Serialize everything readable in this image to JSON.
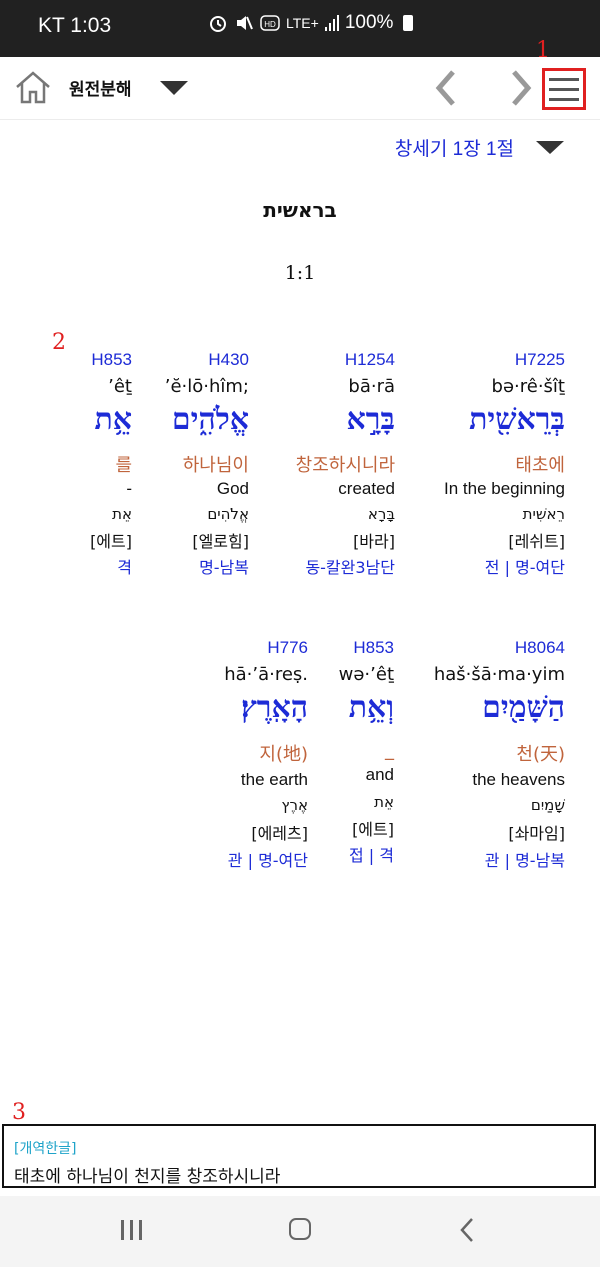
{
  "status_bar": {
    "carrier_time": "KT 1:03",
    "icons": [
      "alarm-icon",
      "mute-icon",
      "hd-icon",
      "lte-icon",
      "signal-icon"
    ],
    "network": "LTE+",
    "battery": "100%"
  },
  "toolbar": {
    "title": "원전분해",
    "annotation": "1"
  },
  "reference": "창세기 1장 1절",
  "book_title": "בראשית",
  "chapter_verse": "1:1",
  "annotation_words": "2",
  "annotation_translation": "3",
  "rows": [
    [
      {
        "strong": "H7225",
        "translit": "bə·rê·šîṯ",
        "hebrew": "בְּרֵאשִׁ֖ית",
        "korean": "태초에",
        "english": "In the beginning",
        "lemma": "רֵאשִׁית",
        "pron": "[레쉬트]",
        "gram": "전 | 명-여단"
      },
      {
        "strong": "H1254",
        "translit": "bā·rā",
        "hebrew": "בָּרָ֣א",
        "korean": "창조하시니라",
        "english": "created",
        "lemma": "בָּרָא",
        "pron": "[바라]",
        "gram": "동-칼완3남단"
      },
      {
        "strong": "H430",
        "translit": "’ĕ·lō·hîm;",
        "hebrew": "אֱלֹהִ֑ים",
        "korean": "하나님이",
        "english": "God",
        "lemma": "אֱלֹהִים",
        "pron": "[엘로힘]",
        "gram": "명-남복"
      },
      {
        "strong": "H853",
        "translit": "’êṯ",
        "hebrew": "אֵ֥ת",
        "korean": "를",
        "english": "-",
        "lemma": "אֵת",
        "pron": "[에트]",
        "gram": "격"
      }
    ],
    [
      {
        "strong": "H8064",
        "translit": "haš·šā·ma·yim",
        "hebrew": "הַשָּׁמַ֖יִם",
        "korean": "천(天)",
        "english": "the heavens",
        "lemma": "שָׁמַיִם",
        "pron": "[솨마임]",
        "gram": "관 | 명-남복"
      },
      {
        "strong": "H853",
        "translit": "wə·’êṯ",
        "hebrew": "וְאֵ֥ת",
        "korean": "_",
        "english": "and",
        "lemma": "אֵת",
        "pron": "[에트]",
        "gram": "접 | 격"
      },
      {
        "strong": "H776",
        "translit": "hā·’ā·reṣ.",
        "hebrew": "הָאָֽרֶץ׃",
        "korean": "지(地)",
        "english": "the earth",
        "lemma": "אֶרֶץ",
        "pron": "[에레츠]",
        "gram": "관 | 명-여단"
      }
    ]
  ],
  "translation": {
    "label": "[개역한글]",
    "text": "태초에 하나님이 천지를 창조하시니라"
  },
  "colors": {
    "link_blue": "#1d2bd6",
    "korean_orange": "#c0643c",
    "annotation_red": "#e02020",
    "label_cyan": "#1ea3c9"
  }
}
